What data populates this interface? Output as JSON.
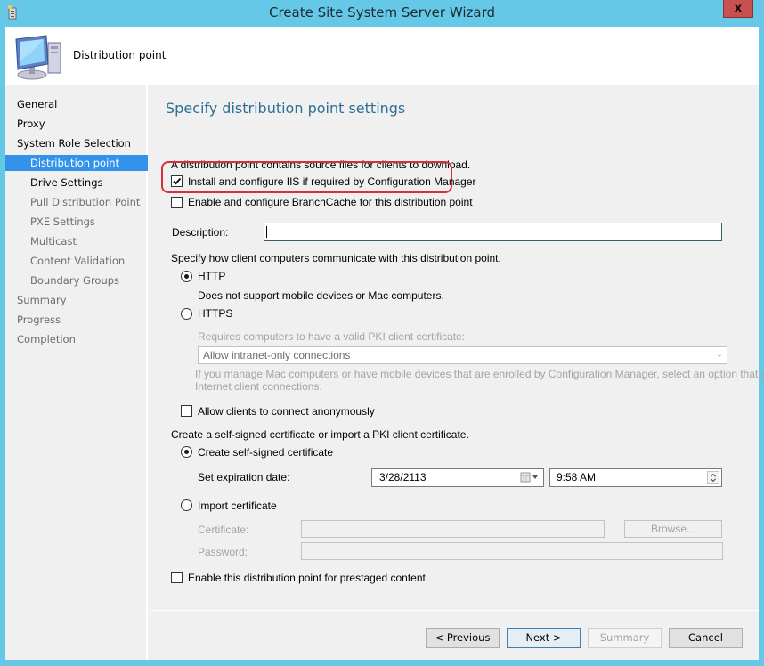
{
  "window": {
    "title": "Create Site System Server Wizard",
    "close_label": "x"
  },
  "header": {
    "title": "Distribution point"
  },
  "sidebar": {
    "items": [
      {
        "label": "General",
        "level": 0,
        "state": "normal"
      },
      {
        "label": "Proxy",
        "level": 0,
        "state": "normal"
      },
      {
        "label": "System Role Selection",
        "level": 0,
        "state": "normal"
      },
      {
        "label": "Distribution point",
        "level": 1,
        "state": "active"
      },
      {
        "label": "Drive Settings",
        "level": 1,
        "state": "normal"
      },
      {
        "label": "Pull Distribution Point",
        "level": 1,
        "state": "disabled"
      },
      {
        "label": "PXE Settings",
        "level": 1,
        "state": "disabled"
      },
      {
        "label": "Multicast",
        "level": 1,
        "state": "disabled"
      },
      {
        "label": "Content Validation",
        "level": 1,
        "state": "disabled"
      },
      {
        "label": "Boundary Groups",
        "level": 1,
        "state": "disabled"
      },
      {
        "label": "Summary",
        "level": 0,
        "state": "disabled"
      },
      {
        "label": "Progress",
        "level": 0,
        "state": "disabled"
      },
      {
        "label": "Completion",
        "level": 0,
        "state": "disabled"
      }
    ]
  },
  "main": {
    "heading": "Specify distribution point settings",
    "intro": "A distribution point contains source files for clients to download.",
    "install_iis": {
      "label": "Install and configure IIS if required by Configuration Manager",
      "checked": true
    },
    "branchcache": {
      "label": "Enable and configure BranchCache for this distribution point",
      "checked": false
    },
    "description": {
      "label": "Description:",
      "value": ""
    },
    "communication": {
      "label": "Specify how client computers communicate with this distribution point.",
      "http": {
        "label": "HTTP",
        "selected": true,
        "note": "Does not support mobile devices or Mac computers."
      },
      "https": {
        "label": "HTTPS",
        "selected": false,
        "note": "Requires computers to have a valid PKI client certificate:",
        "select_value": "Allow intranet-only connections",
        "help_line1": "If you manage Mac computers or have mobile devices that are enrolled by Configuration Manager, select an option that allows",
        "help_line2": "Internet client connections."
      }
    },
    "anonymous": {
      "label": "Allow clients to connect anonymously",
      "checked": false
    },
    "certificate": {
      "label": "Create a self-signed certificate or import a PKI client certificate.",
      "self_signed": {
        "label": "Create self-signed certificate",
        "selected": true
      },
      "expiration_label": "Set expiration date:",
      "expiration_date": "3/28/2113",
      "expiration_time": "9:58 AM",
      "import": {
        "label": "Import certificate",
        "selected": false
      },
      "certificate_label": "Certificate:",
      "certificate_value": "",
      "password_label": "Password:",
      "password_value": "",
      "browse_label": "Browse..."
    },
    "prestaged": {
      "label": "Enable this distribution point for prestaged content",
      "checked": false
    }
  },
  "footer": {
    "previous": "< Previous",
    "next": "Next >",
    "summary": "Summary",
    "cancel": "Cancel"
  }
}
